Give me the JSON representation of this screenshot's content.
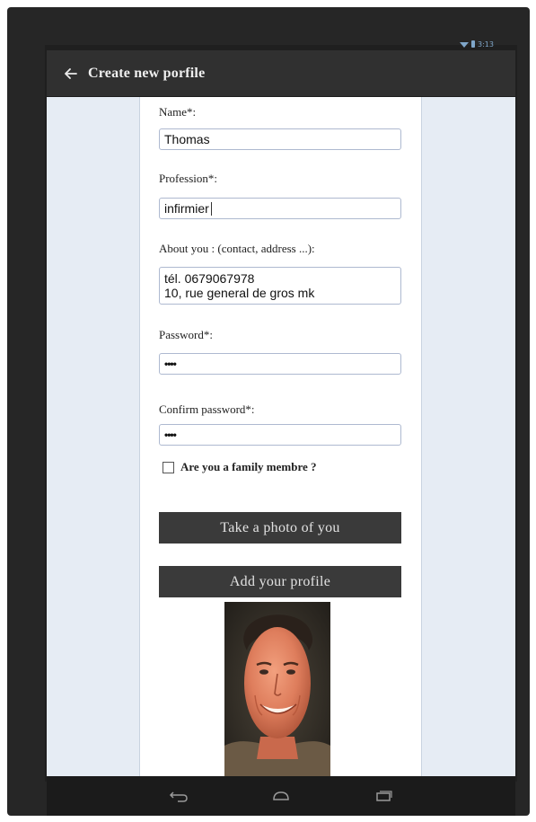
{
  "status_bar": {
    "time": "3:13"
  },
  "app_bar": {
    "title": "Create new porfile"
  },
  "form": {
    "name_label": "Name*:",
    "name_value": "Thomas",
    "profession_label": "Profession*:",
    "profession_value": "infirmier",
    "about_label": "About you : (contact, address ...):",
    "about_line1": "tél. 0679067978",
    "about_line2": "10, rue general de gros mk",
    "password_label": "Password*:",
    "password_value": "••••",
    "confirm_label": "Confirm password*:",
    "confirm_value": "••••",
    "family_checkbox_label": "Are you a family membre ?",
    "family_checked": false,
    "photo_button": "Take a photo of you",
    "add_button": "Add your profile"
  },
  "icons": {
    "back": "arrow-back-icon",
    "nav_back": "nav-back-icon",
    "nav_home": "nav-home-icon",
    "nav_recents": "nav-recents-icon"
  }
}
